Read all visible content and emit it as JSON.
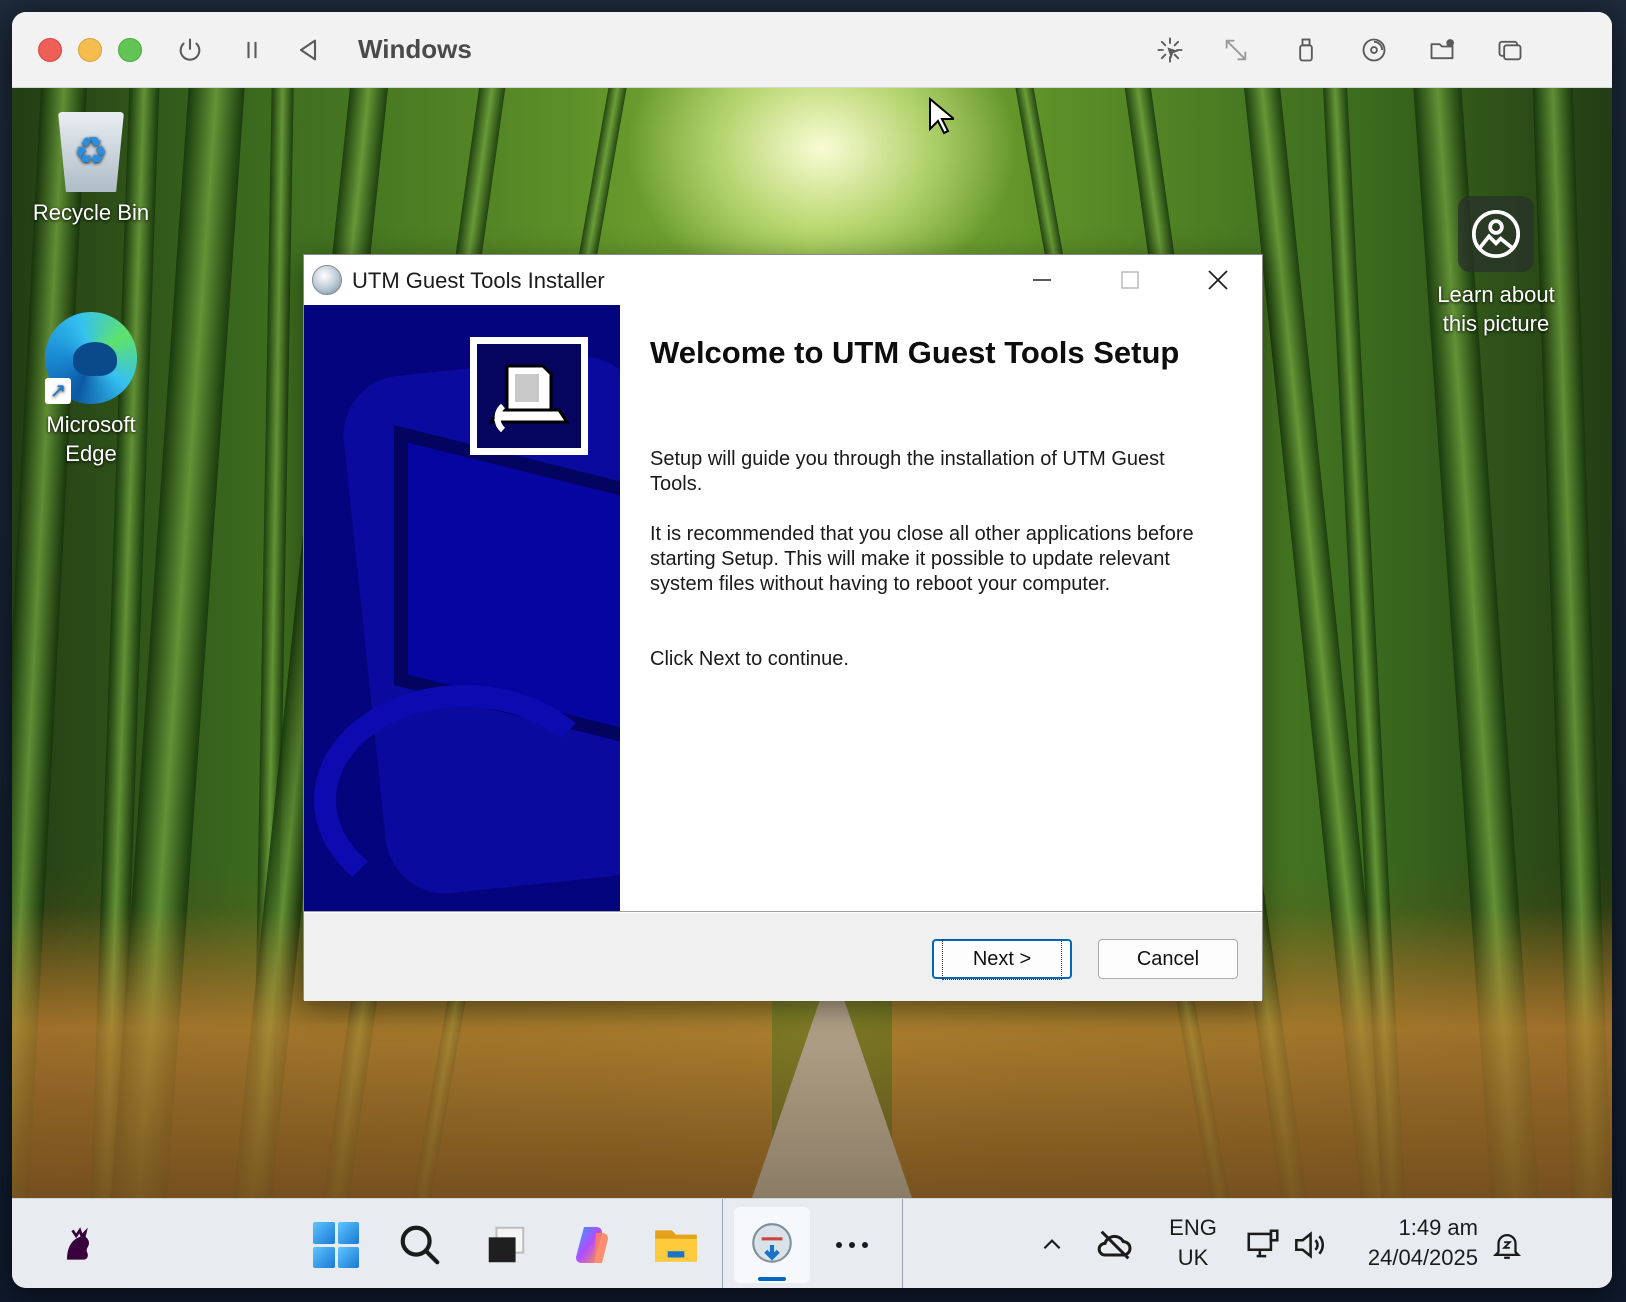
{
  "host": {
    "title": "Windows",
    "toolbar_icons": [
      "power-icon",
      "pause-icon",
      "back-triangle-icon",
      "capture-cursor-icon",
      "resize-icon",
      "usb-icon",
      "cd-dvd-icon",
      "shared-folder-icon",
      "windows-icon"
    ]
  },
  "desktop": {
    "icons": [
      {
        "label": "Recycle Bin"
      },
      {
        "label_line1": "Microsoft",
        "label_line2": "Edge"
      }
    ],
    "spotlight": {
      "line1": "Learn about",
      "line2": "this picture"
    }
  },
  "installer": {
    "title": "UTM Guest Tools Installer",
    "heading": "Welcome to UTM Guest Tools Setup",
    "para1": "Setup will guide you through the installation of UTM Guest Tools.",
    "para2": "It is recommended that you close all other applications before starting Setup. This will make it possible to update relevant system files without having to reboot your computer.",
    "para3": "Click Next to continue.",
    "buttons": {
      "next": "Next >",
      "cancel": "Cancel"
    },
    "banner_color": "#04047e"
  },
  "taskbar": {
    "language_line1": "ENG",
    "language_line2": "UK",
    "time": "1:49 am",
    "date": "24/04/2025",
    "accent": "#0067c0"
  }
}
